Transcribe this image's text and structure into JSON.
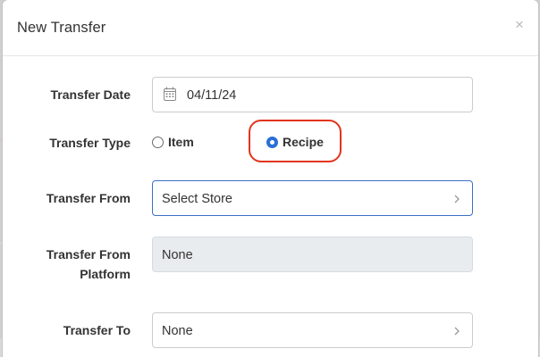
{
  "modal": {
    "title": "New Transfer",
    "close_glyph": "×"
  },
  "form": {
    "transfer_date": {
      "label": "Transfer Date",
      "value": "04/11/24",
      "icon": "calendar-icon"
    },
    "transfer_type": {
      "label": "Transfer Type",
      "options": [
        {
          "label": "Item",
          "selected": false
        },
        {
          "label": "Recipe",
          "selected": true
        }
      ]
    },
    "transfer_from": {
      "label": "Transfer From",
      "value": "Select Store",
      "icon": "chevron-right-icon"
    },
    "transfer_from_platform": {
      "label_line1": "Transfer From",
      "label_line2": "Platform",
      "value": "None"
    },
    "transfer_to": {
      "label": "Transfer To",
      "value": "None",
      "icon": "chevron-right-icon"
    }
  },
  "colors": {
    "accent": "#2a6fd6",
    "highlight": "#e2341d",
    "focus_border": "#3c6fc4",
    "readonly_bg": "#e9ecef"
  }
}
